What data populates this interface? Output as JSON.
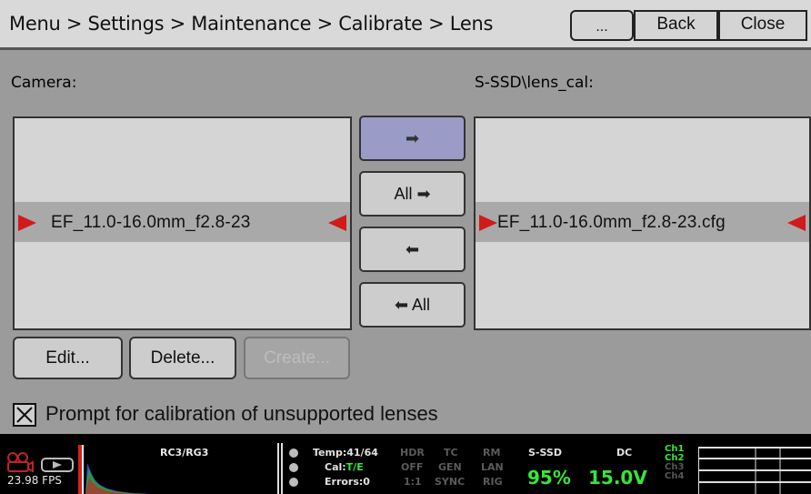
{
  "titlebar": {
    "breadcrumb": "Menu > Settings > Maintenance > Calibrate > Lens",
    "more_label": "...",
    "back_label": "Back",
    "close_label": "Close"
  },
  "panel": {
    "camera_label": "Camera:",
    "ssd_label": "S-SSD\\lens_cal:",
    "camera_list": {
      "selected_item": "EF_11.0-16.0mm_f2.8-23"
    },
    "ssd_list": {
      "selected_item": "EF_11.0-16.0mm_f2.8-23.cfg"
    },
    "transfer_buttons": {
      "copy_one_glyph": "➡",
      "copy_all_label": "All",
      "copy_all_glyph": "➡",
      "back_one_glyph": "⬅",
      "back_all_glyph": "⬅",
      "back_all_label": "All"
    },
    "actions": {
      "edit_label": "Edit...",
      "delete_label": "Delete...",
      "create_label": "Create..."
    },
    "checkbox": {
      "label": "Prompt for calibration of unsupported lenses",
      "checked": true
    }
  },
  "statusbar": {
    "fps": "23.98 FPS",
    "color_label": "RC3/RG3",
    "temp": "Temp:41/64",
    "cal_prefix": "Cal:",
    "cal_value": "T/E",
    "errors": "Errors:0",
    "indicators": {
      "hdr": "HDR",
      "off": "OFF",
      "ratio": "1:1",
      "tc": "TC",
      "gen": "GEN",
      "sync": "SYNC",
      "rm": "RM",
      "lan": "LAN",
      "rig": "RIG"
    },
    "media_label": "S-SSD",
    "media_value": "95%",
    "power_label": "DC",
    "power_value": "15.0V",
    "channels": [
      "Ch1",
      "Ch2",
      "Ch3",
      "Ch4"
    ],
    "colors": {
      "green": "#37e637",
      "red": "#d11b1b",
      "selected_button": "#9b9bc8"
    }
  }
}
